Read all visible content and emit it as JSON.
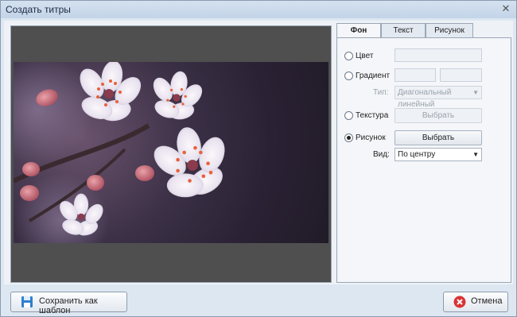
{
  "window": {
    "title": "Создать титры",
    "close_symbol": "✕"
  },
  "tabs": [
    {
      "label": "Фон",
      "active": true
    },
    {
      "label": "Текст",
      "active": false
    },
    {
      "label": "Рисунок",
      "active": false
    }
  ],
  "background": {
    "color_label": "Цвет",
    "gradient_label": "Градиент",
    "type_label": "Тип:",
    "type_value": "Диагональный линейный",
    "texture_label": "Текстура",
    "texture_button": "Выбрать",
    "image_label": "Рисунок",
    "image_button": "Выбрать",
    "view_label": "Вид:",
    "view_value": "По центру",
    "selected": "image"
  },
  "footer": {
    "save_template_label": "Сохранить как шаблон",
    "cancel_label": "Отмена"
  },
  "icons": {
    "save": "floppy-disk-icon",
    "cancel": "cancel-icon"
  }
}
